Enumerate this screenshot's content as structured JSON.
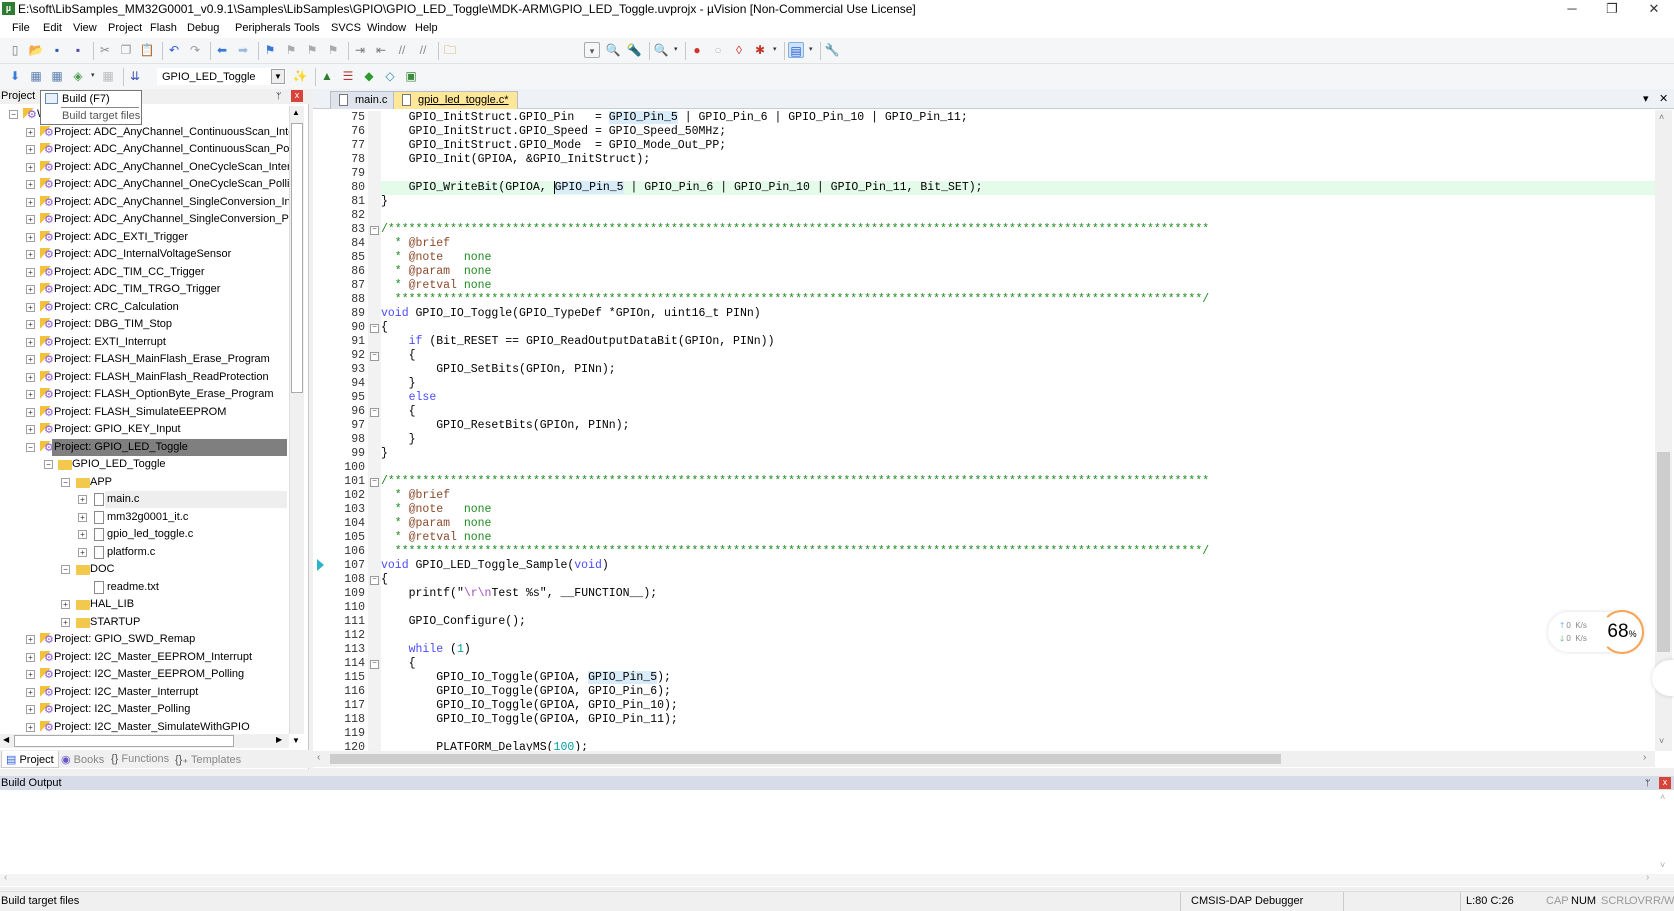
{
  "window": {
    "title": "E:\\soft\\LibSamples_MM32G0001_v0.9.1\\Samples\\LibSamples\\GPIO\\GPIO_LED_Toggle\\MDK-ARM\\GPIO_LED_Toggle.uvprojx - µVision  [Non-Commercial Use License]",
    "minimize": "─",
    "restore": "❐",
    "close": "✕"
  },
  "menu": [
    "File",
    "Edit",
    "View",
    "Project",
    "Flash",
    "Debug",
    "Peripherals",
    "Tools",
    "SVCS",
    "Window",
    "Help"
  ],
  "toolbar1": [
    "new-file",
    "open-file",
    "save",
    "save-all",
    "|",
    "cut",
    "copy",
    "paste",
    "|",
    "undo",
    "redo",
    "|",
    "navigate-back",
    "navigate-forward",
    "|",
    "bookmark",
    "prev-bookmark",
    "next-bookmark",
    "clear-bookmarks",
    "|",
    "indent",
    "unindent",
    "comment",
    "uncomment",
    "|",
    "find-in-files",
    "combo-dropdown",
    "find",
    "incremental-find",
    "|",
    "debug-session",
    "dropdown",
    "|",
    "breakpoint",
    "disable-breakpoint",
    "kill-breakpoints",
    "breakpoints-dropdown",
    "dropdown",
    "|",
    "window-layout",
    "dropdown",
    "|",
    "configure"
  ],
  "toolbar2": [
    "translate",
    "build",
    "rebuild",
    "batch-build",
    "dropdown",
    "stop-build",
    "|",
    "download",
    "target-combo",
    "target-options",
    "|",
    "manage-components",
    "select-packs",
    "pack-installer",
    "software-packs",
    "event-recorder"
  ],
  "target": "GPIO_LED_Toggle",
  "tooltip": {
    "title": "Build (F7)",
    "desc": "Build target files"
  },
  "project_panel": {
    "title": "Project",
    "pin": "ᛘ",
    "close": "x",
    "tree": [
      {
        "label": "WorkSpace",
        "level": 0,
        "type": "workspace",
        "exp": "-"
      },
      {
        "label": "Project: ADC_AnyChannel_ContinuousScan_Interrupt",
        "level": 1,
        "type": "project",
        "exp": "+"
      },
      {
        "label": "Project: ADC_AnyChannel_ContinuousScan_Polling",
        "level": 1,
        "type": "project",
        "exp": "+"
      },
      {
        "label": "Project: ADC_AnyChannel_OneCycleScan_Interrupt",
        "level": 1,
        "type": "project",
        "exp": "+"
      },
      {
        "label": "Project: ADC_AnyChannel_OneCycleScan_Polling",
        "level": 1,
        "type": "project",
        "exp": "+"
      },
      {
        "label": "Project: ADC_AnyChannel_SingleConversion_Interrupt",
        "level": 1,
        "type": "project",
        "exp": "+"
      },
      {
        "label": "Project: ADC_AnyChannel_SingleConversion_Polling",
        "level": 1,
        "type": "project",
        "exp": "+"
      },
      {
        "label": "Project: ADC_EXTI_Trigger",
        "level": 1,
        "type": "project",
        "exp": "+"
      },
      {
        "label": "Project: ADC_InternalVoltageSensor",
        "level": 1,
        "type": "project",
        "exp": "+"
      },
      {
        "label": "Project: ADC_TIM_CC_Trigger",
        "level": 1,
        "type": "project",
        "exp": "+"
      },
      {
        "label": "Project: ADC_TIM_TRGO_Trigger",
        "level": 1,
        "type": "project",
        "exp": "+"
      },
      {
        "label": "Project: CRC_Calculation",
        "level": 1,
        "type": "project",
        "exp": "+"
      },
      {
        "label": "Project: DBG_TIM_Stop",
        "level": 1,
        "type": "project",
        "exp": "+"
      },
      {
        "label": "Project: EXTI_Interrupt",
        "level": 1,
        "type": "project",
        "exp": "+"
      },
      {
        "label": "Project: FLASH_MainFlash_Erase_Program",
        "level": 1,
        "type": "project",
        "exp": "+"
      },
      {
        "label": "Project: FLASH_MainFlash_ReadProtection",
        "level": 1,
        "type": "project",
        "exp": "+"
      },
      {
        "label": "Project: FLASH_OptionByte_Erase_Program",
        "level": 1,
        "type": "project",
        "exp": "+"
      },
      {
        "label": "Project: FLASH_SimulateEEPROM",
        "level": 1,
        "type": "project",
        "exp": "+"
      },
      {
        "label": "Project: GPIO_KEY_Input",
        "level": 1,
        "type": "project",
        "exp": "+"
      },
      {
        "label": "Project: GPIO_LED_Toggle",
        "level": 1,
        "type": "project",
        "exp": "-",
        "selected": true
      },
      {
        "label": "GPIO_LED_Toggle",
        "level": 2,
        "type": "target",
        "exp": "-"
      },
      {
        "label": "APP",
        "level": 3,
        "type": "folder",
        "exp": "-"
      },
      {
        "label": "main.c",
        "level": 4,
        "type": "file",
        "exp": "+",
        "hover": true
      },
      {
        "label": "mm32g0001_it.c",
        "level": 4,
        "type": "file",
        "exp": "+"
      },
      {
        "label": "gpio_led_toggle.c",
        "level": 4,
        "type": "file",
        "exp": "+"
      },
      {
        "label": "platform.c",
        "level": 4,
        "type": "file",
        "exp": "+"
      },
      {
        "label": "DOC",
        "level": 3,
        "type": "folder",
        "exp": "-"
      },
      {
        "label": "readme.txt",
        "level": 4,
        "type": "file",
        "exp": ""
      },
      {
        "label": "HAL_LIB",
        "level": 3,
        "type": "folder",
        "exp": "+"
      },
      {
        "label": "STARTUP",
        "level": 3,
        "type": "folder",
        "exp": "+"
      },
      {
        "label": "Project: GPIO_SWD_Remap",
        "level": 1,
        "type": "project",
        "exp": "+"
      },
      {
        "label": "Project: I2C_Master_EEPROM_Interrupt",
        "level": 1,
        "type": "project",
        "exp": "+"
      },
      {
        "label": "Project: I2C_Master_EEPROM_Polling",
        "level": 1,
        "type": "project",
        "exp": "+"
      },
      {
        "label": "Project: I2C_Master_Interrupt",
        "level": 1,
        "type": "project",
        "exp": "+"
      },
      {
        "label": "Project: I2C_Master_Polling",
        "level": 1,
        "type": "project",
        "exp": "+"
      },
      {
        "label": "Project: I2C_Master_SimulateWithGPIO",
        "level": 1,
        "type": "project",
        "exp": "+"
      }
    ],
    "tabs": [
      {
        "label": "Project",
        "icon": "project-icon",
        "active": true
      },
      {
        "label": "Books",
        "icon": "books-icon"
      },
      {
        "label": "Functions",
        "icon": "functions-icon"
      },
      {
        "label": "Templates",
        "icon": "templates-icon"
      }
    ]
  },
  "editor": {
    "tabs": [
      {
        "label": "main.c",
        "active": false
      },
      {
        "label": "gpio_led_toggle.c*",
        "active": true
      }
    ],
    "tab_menu": "▾",
    "tab_close": "✕",
    "current_line": 80,
    "caret_col": 26,
    "highlight_word": "GPIO_Pin_5",
    "debug_arrow_line": 107,
    "fold_lines": [
      83,
      90,
      92,
      96,
      101,
      108,
      114
    ],
    "lines": [
      {
        "n": 75,
        "text": "    GPIO_InitStruct.GPIO_Pin   = GPIO_Pin_5 | GPIO_Pin_6 | GPIO_Pin_10 | GPIO_Pin_11;"
      },
      {
        "n": 76,
        "text": "    GPIO_InitStruct.GPIO_Speed = GPIO_Speed_50MHz;"
      },
      {
        "n": 77,
        "text": "    GPIO_InitStruct.GPIO_Mode  = GPIO_Mode_Out_PP;"
      },
      {
        "n": 78,
        "text": "    GPIO_Init(GPIOA, &GPIO_InitStruct);"
      },
      {
        "n": 79,
        "text": ""
      },
      {
        "n": 80,
        "text": "    GPIO_WriteBit(GPIOA, GPIO_Pin_5 | GPIO_Pin_6 | GPIO_Pin_10 | GPIO_Pin_11, Bit_SET);"
      },
      {
        "n": 81,
        "text": "}"
      },
      {
        "n": 82,
        "text": ""
      },
      {
        "n": 83,
        "text": "/***********************************************************************************************************************"
      },
      {
        "n": 84,
        "text": "  * @brief"
      },
      {
        "n": 85,
        "text": "  * @note   none"
      },
      {
        "n": 86,
        "text": "  * @param  none"
      },
      {
        "n": 87,
        "text": "  * @retval none"
      },
      {
        "n": 88,
        "text": "  *********************************************************************************************************************/"
      },
      {
        "n": 89,
        "text": "void GPIO_IO_Toggle(GPIO_TypeDef *GPIOn, uint16_t PINn)"
      },
      {
        "n": 90,
        "text": "{"
      },
      {
        "n": 91,
        "text": "    if (Bit_RESET == GPIO_ReadOutputDataBit(GPIOn, PINn))"
      },
      {
        "n": 92,
        "text": "    {"
      },
      {
        "n": 93,
        "text": "        GPIO_SetBits(GPIOn, PINn);"
      },
      {
        "n": 94,
        "text": "    }"
      },
      {
        "n": 95,
        "text": "    else"
      },
      {
        "n": 96,
        "text": "    {"
      },
      {
        "n": 97,
        "text": "        GPIO_ResetBits(GPIOn, PINn);"
      },
      {
        "n": 98,
        "text": "    }"
      },
      {
        "n": 99,
        "text": "}"
      },
      {
        "n": 100,
        "text": ""
      },
      {
        "n": 101,
        "text": "/***********************************************************************************************************************"
      },
      {
        "n": 102,
        "text": "  * @brief"
      },
      {
        "n": 103,
        "text": "  * @note   none"
      },
      {
        "n": 104,
        "text": "  * @param  none"
      },
      {
        "n": 105,
        "text": "  * @retval none"
      },
      {
        "n": 106,
        "text": "  *********************************************************************************************************************/"
      },
      {
        "n": 107,
        "text": "void GPIO_LED_Toggle_Sample(void)"
      },
      {
        "n": 108,
        "text": "{"
      },
      {
        "n": 109,
        "text": "    printf(\"\\r\\nTest %s\", __FUNCTION__);"
      },
      {
        "n": 110,
        "text": ""
      },
      {
        "n": 111,
        "text": "    GPIO_Configure();"
      },
      {
        "n": 112,
        "text": ""
      },
      {
        "n": 113,
        "text": "    while (1)"
      },
      {
        "n": 114,
        "text": "    {"
      },
      {
        "n": 115,
        "text": "        GPIO_IO_Toggle(GPIOA, GPIO_Pin_5);"
      },
      {
        "n": 116,
        "text": "        GPIO_IO_Toggle(GPIOA, GPIO_Pin_6);"
      },
      {
        "n": 117,
        "text": "        GPIO_IO_Toggle(GPIOA, GPIO_Pin_10);"
      },
      {
        "n": 118,
        "text": "        GPIO_IO_Toggle(GPIOA, GPIO_Pin_11);"
      },
      {
        "n": 119,
        "text": ""
      },
      {
        "n": 120,
        "text": "        PLATFORM_DelayMS(100);"
      }
    ]
  },
  "net_widget": {
    "up": "0",
    "down": "0",
    "unit": "K/s",
    "percent": "68",
    "percent_sign": "%",
    "up_arrow": "🡑",
    "down_arrow": "🡓"
  },
  "build_output": {
    "title": "Build Output",
    "pin": "ᛘ",
    "close": "x"
  },
  "status": {
    "left": "Build target files",
    "debugger": "CMSIS-DAP Debugger",
    "position": "L:80 C:26",
    "cap": "CAP",
    "num": "NUM",
    "scrl": "SCRL",
    "ovr": "OVR",
    "rw": "R/W"
  },
  "colors": {
    "keyword": "#4b4bff",
    "comment": "#1e8a1e",
    "number": "#00a0a0",
    "current_line": "#e5fbe9",
    "active_tab": "#ffe79a",
    "selection": "#7f7f7f"
  }
}
